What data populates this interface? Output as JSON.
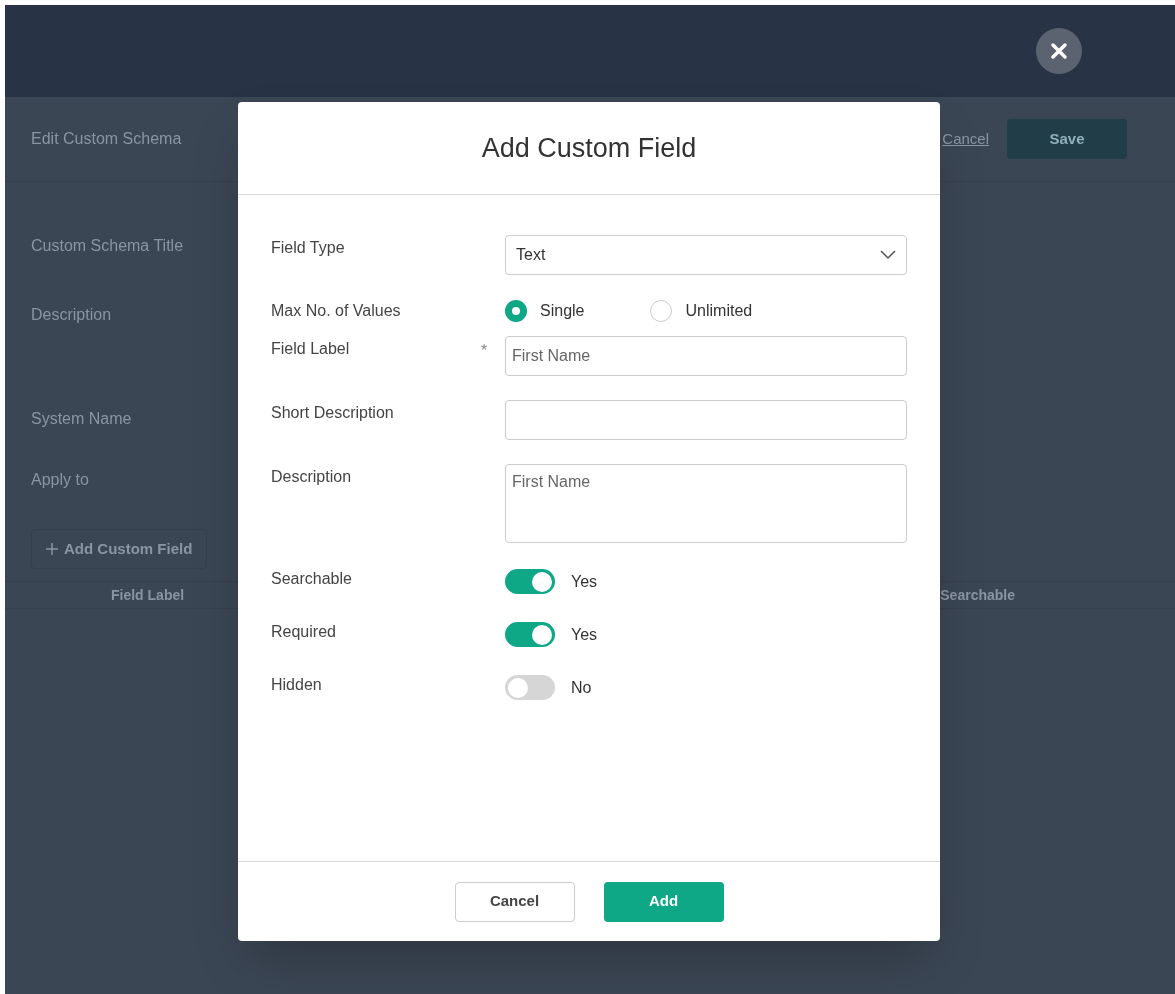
{
  "page": {
    "title": "Edit Custom Schema",
    "cancel": "Cancel",
    "save": "Save",
    "form_labels": [
      "Custom Schema Title",
      "Description",
      "System Name",
      "Apply to"
    ],
    "add_button": "Add Custom Field",
    "table_columns": [
      "Field Label",
      "Searchable"
    ]
  },
  "dialog": {
    "title": "Add Custom Field",
    "field_type": {
      "label": "Field Type",
      "value": "Text"
    },
    "max_values": {
      "label": "Max No. of Values",
      "options": [
        {
          "label": "Single",
          "selected": true
        },
        {
          "label": "Unlimited",
          "selected": false
        }
      ]
    },
    "field_label": {
      "label": "Field Label",
      "required_mark": "*",
      "placeholder": "First Name"
    },
    "short_description": {
      "label": "Short Description"
    },
    "description": {
      "label": "Description",
      "placeholder": "First Name"
    },
    "toggles": [
      {
        "label": "Searchable",
        "on": true,
        "state_text": "Yes"
      },
      {
        "label": "Required",
        "on": true,
        "state_text": "Yes"
      },
      {
        "label": "Hidden",
        "on": false,
        "state_text": "No"
      }
    ],
    "buttons": {
      "cancel": "Cancel",
      "add": "Add"
    }
  }
}
